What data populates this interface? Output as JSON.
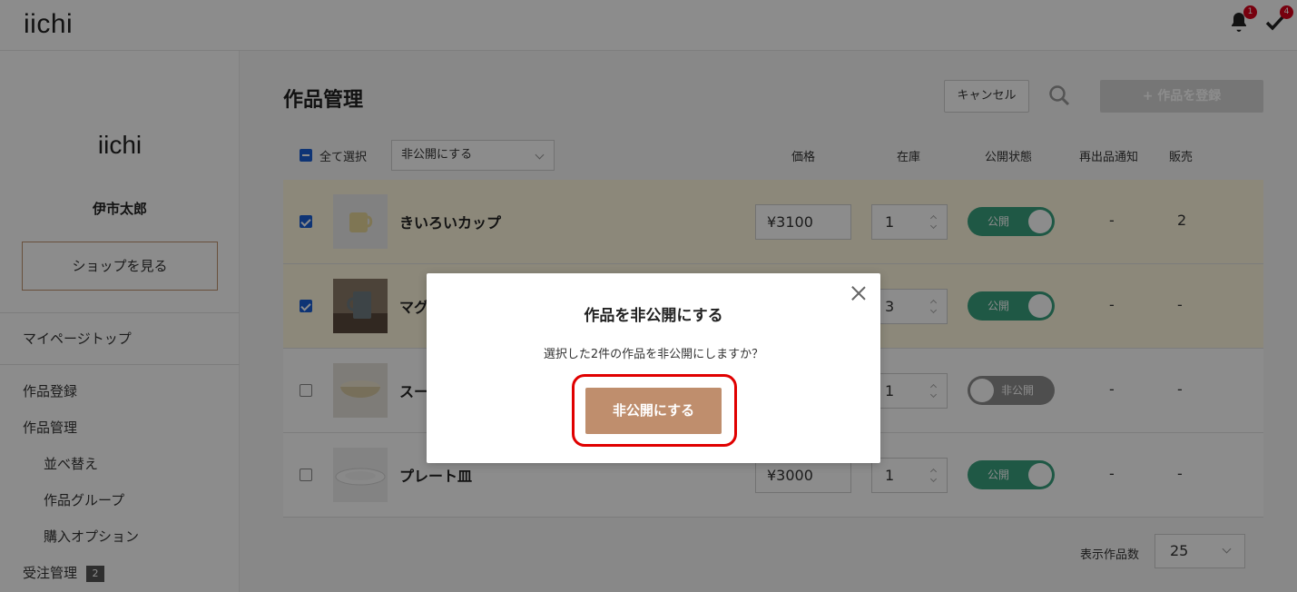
{
  "header": {
    "logo": "iichi",
    "notifications_count": "1",
    "tasks_count": "4",
    "bell_icon": "bell-icon",
    "check_icon": "checkmark-icon"
  },
  "sidebar": {
    "shop_name": "iichi",
    "owner_name": "伊市太郎",
    "view_shop_label": "ショップを見る",
    "mypage_top": "マイページトップ",
    "items": [
      {
        "label": "作品登録"
      },
      {
        "label": "作品管理"
      },
      {
        "label": "並べ替え"
      },
      {
        "label": "作品グループ"
      },
      {
        "label": "購入オプション"
      },
      {
        "label": "受注管理",
        "badge": "2"
      }
    ]
  },
  "main": {
    "title": "作品管理",
    "cancel_label": "キャンセル",
    "register_label": "+ 作品を登録",
    "select_all_label": "全て選択",
    "bulk_action_value": "非公開にする",
    "columns": {
      "price": "価格",
      "stock": "在庫",
      "status": "公開状態",
      "restock": "再出品通知",
      "sales": "販売"
    },
    "rows": [
      {
        "name": "きいろいカップ",
        "price": "¥3100",
        "stock": "1",
        "status": "公開",
        "restock": "-",
        "sales": "2",
        "checked": true
      },
      {
        "name": "マグ",
        "price": "",
        "stock": "3",
        "status": "公開",
        "restock": "-",
        "sales": "-",
        "checked": true
      },
      {
        "name": "スー",
        "price": "",
        "stock": "1",
        "status": "非公開",
        "restock": "-",
        "sales": "-",
        "checked": false
      },
      {
        "name": "プレート皿",
        "price": "¥3000",
        "stock": "1",
        "status": "公開",
        "restock": "-",
        "sales": "-",
        "checked": false
      }
    ],
    "per_page_label": "表示作品数",
    "per_page_value": "25"
  },
  "dialog": {
    "title": "作品を非公開にする",
    "message": "選択した2件の作品を非公開にしますか？",
    "confirm_label": "非公開にする"
  },
  "colors": {
    "accent_toggle": "#3aa17e",
    "confirm_button": "#bf8e6d",
    "highlight_ring": "#e00000",
    "selected_row": "#fff7df"
  }
}
